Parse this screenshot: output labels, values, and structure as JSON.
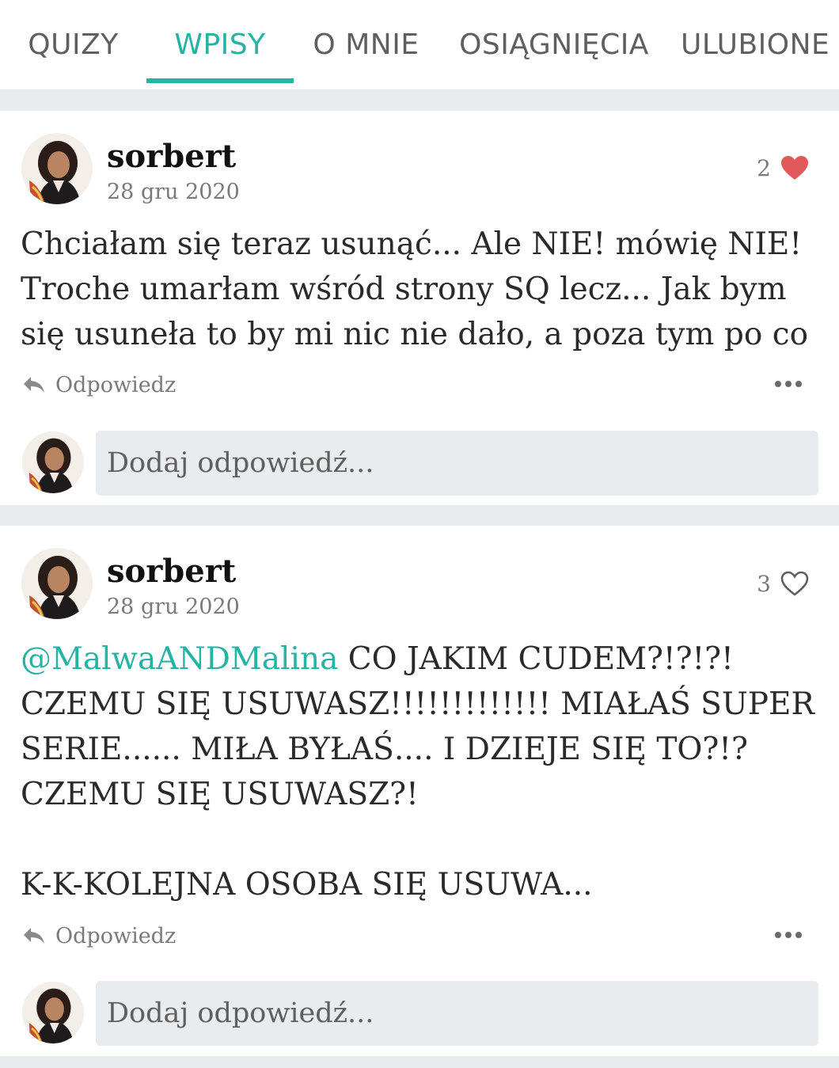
{
  "tabs": [
    {
      "label": "QUIZY",
      "active": false
    },
    {
      "label": "WPISY",
      "active": true
    },
    {
      "label": "O MNIE",
      "active": false
    },
    {
      "label": "OSIĄGNIĘCIA",
      "active": false
    },
    {
      "label": "ULUBIONE",
      "active": false
    }
  ],
  "colors": {
    "accent": "#26b3a3",
    "heart_filled": "#e05a5a",
    "background": "#e9ecee"
  },
  "posts": [
    {
      "username": "sorbert",
      "date": "28 gru 2020",
      "likes": "2",
      "liked": true,
      "mention": "",
      "text": "Chciałam się teraz usunąć... Ale NIE! mówię NIE! Troche umarłam wśród strony SQ lecz... Jak bym się usuneła to by mi nic nie dało, a poza tym po co",
      "reply_label": "Odpowiedz",
      "reply_placeholder": "Dodaj odpowiedź..."
    },
    {
      "username": "sorbert",
      "date": "28 gru 2020",
      "likes": "3",
      "liked": false,
      "mention": "@MalwaANDMalina",
      "text": " CO JAKIM CUDEM?!?!?! CZEMU SIĘ USUWASZ!!!!!!!!!!!!! MIAŁAŚ SUPER SERIE...... MIŁA BYŁAŚ.... I DZIEJE SIĘ TO?!? CZEMU SIĘ USUWASZ?!\n\nK-K-KOLEJNA OSOBA SIĘ USUWA...",
      "reply_label": "Odpowiedz",
      "reply_placeholder": "Dodaj odpowiedź..."
    }
  ]
}
